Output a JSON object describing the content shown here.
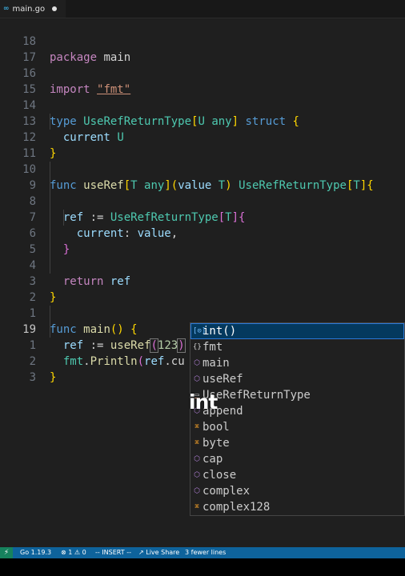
{
  "tab": {
    "icon": "go-icon",
    "filename": "main.go"
  },
  "editor": {
    "lines": [
      {
        "n": "18",
        "code": "package main"
      },
      {
        "n": "17",
        "code": ""
      },
      {
        "n": "16",
        "code": "import \"fmt\""
      },
      {
        "n": "15",
        "code": ""
      },
      {
        "n": "14",
        "code": "type UseRefReturnType[U any] struct {"
      },
      {
        "n": "13",
        "code": "  current U"
      },
      {
        "n": "12",
        "code": "}"
      },
      {
        "n": "11",
        "code": ""
      },
      {
        "n": "10",
        "code": "func useRef[T any](value T) UseRefReturnType[T]{"
      },
      {
        "n": "9",
        "code": ""
      },
      {
        "n": "8",
        "code": "  ref := UseRefReturnType[T]{"
      },
      {
        "n": "7",
        "code": "    current: value,"
      },
      {
        "n": "6",
        "code": "  }"
      },
      {
        "n": "5",
        "code": ""
      },
      {
        "n": "4",
        "code": "  return ref"
      },
      {
        "n": "3",
        "code": "}"
      },
      {
        "n": "2",
        "code": ""
      },
      {
        "n": "1",
        "code": "func main() {"
      },
      {
        "n": "19",
        "code": "  ref := useRef(123)"
      },
      {
        "n": "1",
        "code": "  fmt.Println(ref.cu"
      },
      {
        "n": "2",
        "code": "}"
      },
      {
        "n": "3",
        "code": ""
      }
    ]
  },
  "suggestions": [
    {
      "icon": "var",
      "label": "int()"
    },
    {
      "icon": "mod",
      "label": "fmt"
    },
    {
      "icon": "cube",
      "label": "main"
    },
    {
      "icon": "cube",
      "label": "useRef"
    },
    {
      "icon": "str",
      "label": "UseRefReturnType"
    },
    {
      "icon": "cube",
      "label": "append"
    },
    {
      "icon": "cls",
      "label": "bool"
    },
    {
      "icon": "cls",
      "label": "byte"
    },
    {
      "icon": "cube",
      "label": "cap"
    },
    {
      "icon": "cube",
      "label": "close"
    },
    {
      "icon": "cube",
      "label": "complex"
    },
    {
      "icon": "cls",
      "label": "complex128"
    }
  ],
  "overlay_text": "int",
  "status": {
    "remote": "⚡",
    "go_version": "Go 1.19.3",
    "problems": "⊗ 1 ⚠ 0",
    "mode": "-- INSERT --",
    "live_share": "Live Share",
    "message": "3 fewer lines"
  }
}
